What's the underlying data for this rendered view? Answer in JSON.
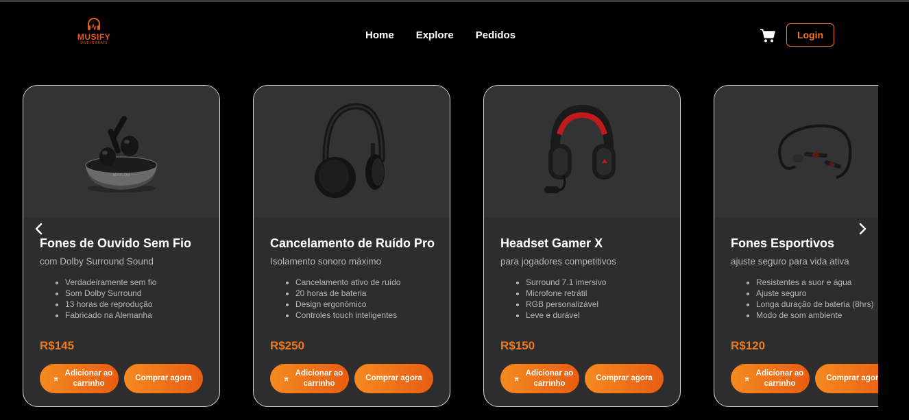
{
  "brand": {
    "name": "MUSIFY",
    "tagline": "DIVE IN BEATS"
  },
  "nav": {
    "items": [
      "Home",
      "Explore",
      "Pedidos"
    ]
  },
  "header": {
    "login_label": "Login"
  },
  "colors": {
    "accent": "#f07a20",
    "card_bg": "#2d2d2d",
    "page_bg": "#000000"
  },
  "products": [
    {
      "title": "Fones de Ouvido Sem Fio",
      "subtitle": "com Dolby Surround Sound",
      "features": [
        "Verdadeiramente sem fio",
        "Som Dolby Surround",
        "13 horas de reprodução",
        "Fabricado na Alemanha"
      ],
      "price": "R$145",
      "add_label": "Adicionar ao carrinho",
      "buy_label": "Comprar agora",
      "image": "earbuds-case"
    },
    {
      "title": "Cancelamento de Ruído Pro",
      "subtitle": "Isolamento sonoro máximo",
      "features": [
        "Cancelamento ativo de ruído",
        "20 horas de bateria",
        "Design ergonômico",
        "Controles touch inteligentes"
      ],
      "price": "R$250",
      "add_label": "Adicionar ao carrinho",
      "buy_label": "Comprar agora",
      "image": "over-ear-headphones"
    },
    {
      "title": "Headset Gamer X",
      "subtitle": "para jogadores competitivos",
      "features": [
        "Surround 7.1 imersivo",
        "Microfone retrátil",
        "RGB personalizável",
        "Leve e durável"
      ],
      "price": "R$150",
      "add_label": "Adicionar ao carrinho",
      "buy_label": "Comprar agora",
      "image": "gaming-headset"
    },
    {
      "title": "Fones Esportivos",
      "subtitle": "ajuste seguro para vida ativa",
      "features": [
        "Resistentes a suor e água",
        "Ajuste seguro",
        "Longa duração de bateria (8hrs)",
        "Modo de som ambiente"
      ],
      "price": "R$120",
      "add_label": "Adicionar ao carrinho",
      "buy_label": "Comprar agora",
      "image": "neckband-earphones"
    }
  ]
}
